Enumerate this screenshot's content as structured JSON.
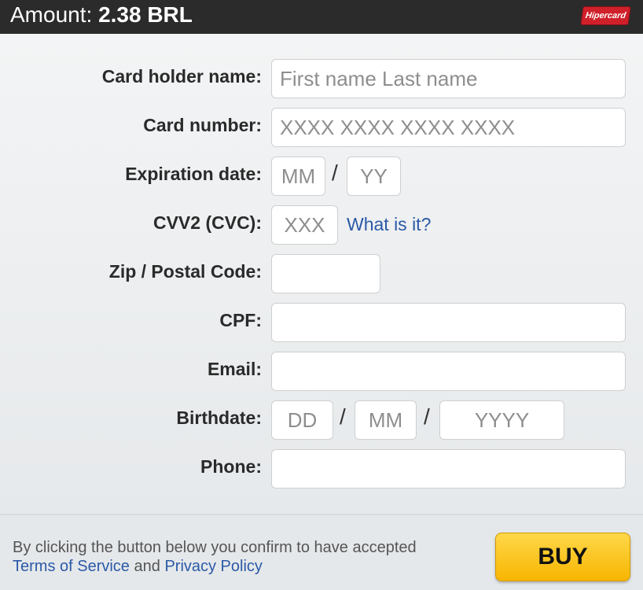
{
  "header": {
    "amount_label": "Amount:",
    "amount_value": "2.38 BRL",
    "brand": "Hipercard"
  },
  "form": {
    "card_holder": {
      "label": "Card holder name:",
      "placeholder": "First name Last name"
    },
    "card_number": {
      "label": "Card number:",
      "placeholder": "XXXX XXXX XXXX XXXX"
    },
    "expiration": {
      "label": "Expiration date:",
      "month_placeholder": "MM",
      "year_placeholder": "YY",
      "separator": "/"
    },
    "cvv": {
      "label": "CVV2 (CVC):",
      "placeholder": "XXX",
      "help_link": "What is it?"
    },
    "zip": {
      "label": "Zip / Postal Code:",
      "value": ""
    },
    "cpf": {
      "label": "CPF:",
      "value": ""
    },
    "email": {
      "label": "Email:",
      "value": ""
    },
    "birthdate": {
      "label": "Birthdate:",
      "day_placeholder": "DD",
      "month_placeholder": "MM",
      "year_placeholder": "YYYY",
      "separator": "/"
    },
    "phone": {
      "label": "Phone:",
      "value": ""
    }
  },
  "footer": {
    "consent_text": "By clicking the button below you confirm to have accepted",
    "terms_link": "Terms of Service",
    "and_text": "and",
    "privacy_link": "Privacy Policy",
    "buy_label": "BUY"
  },
  "colors": {
    "header_bg": "#2b2b2b",
    "buy_button": "#f7b500",
    "link": "#2b5aa8",
    "brand_red": "#d0202a"
  }
}
